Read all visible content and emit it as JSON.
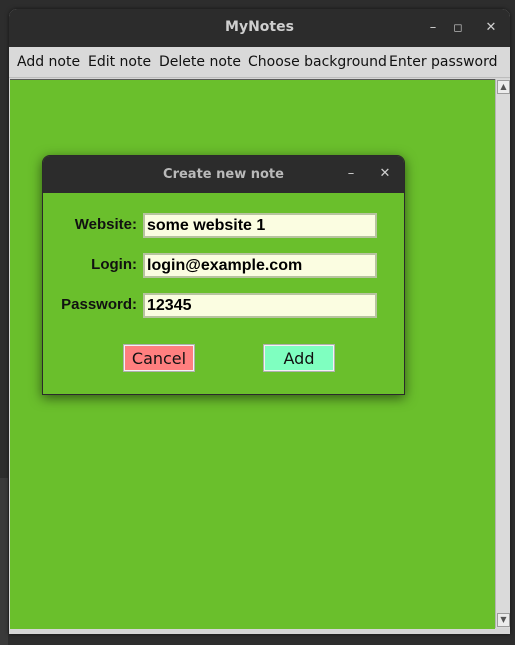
{
  "window": {
    "title": "MyNotes",
    "minimize_glyph": "–",
    "maximize_glyph": "◻",
    "close_glyph": "✕"
  },
  "menu": {
    "items": [
      "Add note",
      "Edit note",
      "Delete note",
      "Choose background",
      "Enter password"
    ]
  },
  "canvas": {
    "background_color": "#6abf2c"
  },
  "dialog": {
    "title": "Create new note",
    "minimize_glyph": "–",
    "close_glyph": "✕",
    "fields": [
      {
        "label": "Website:",
        "value": "some website 1"
      },
      {
        "label": "Login:",
        "value": "login@example.com"
      },
      {
        "label": "Password:",
        "value": "12345"
      }
    ],
    "cancel_label": "Cancel",
    "add_label": "Add",
    "cancel_color": "#ff7f7f",
    "add_color": "#7fffc0",
    "input_bg": "#fbfde1"
  },
  "icons": {
    "scroll_up": "up-arrow-icon",
    "scroll_down": "down-arrow-icon"
  }
}
